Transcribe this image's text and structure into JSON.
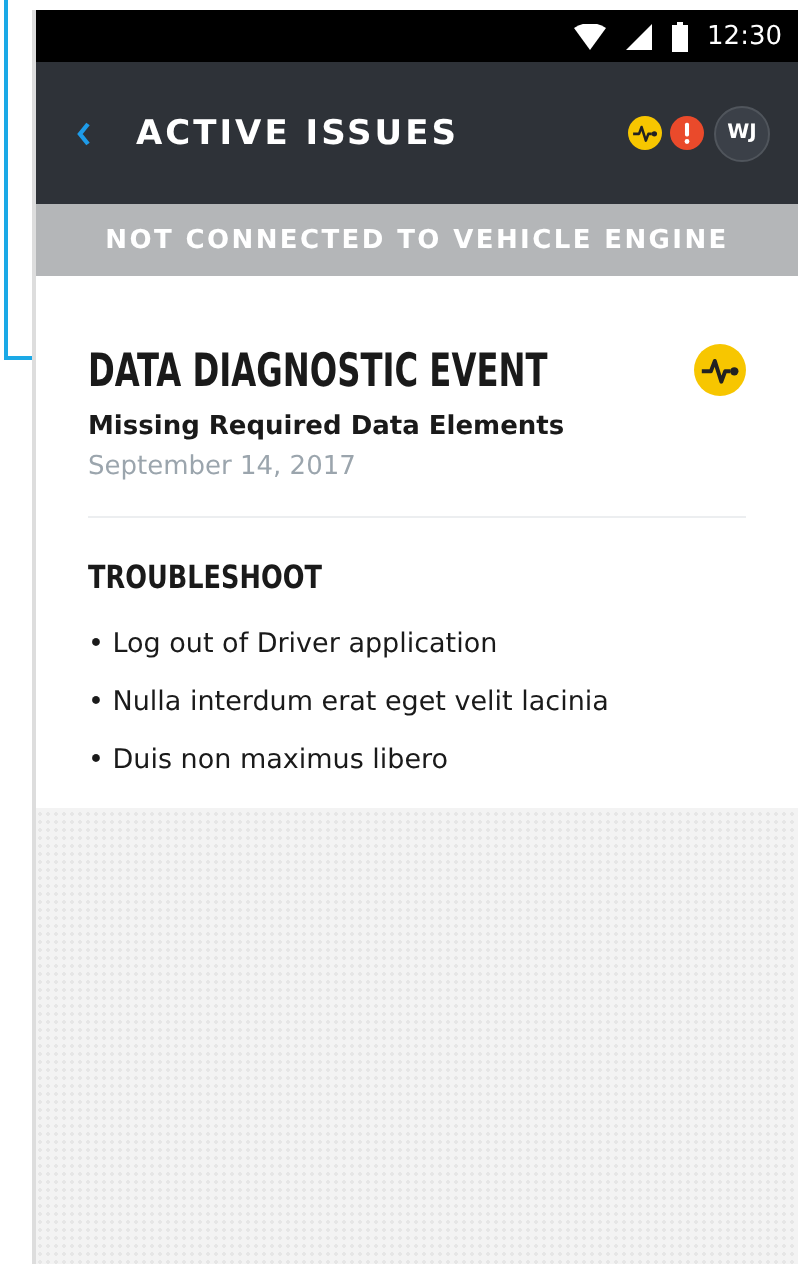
{
  "status_bar": {
    "time": "12:30"
  },
  "header": {
    "title": "ACTIVE ISSUES",
    "indicators": [
      {
        "kind": "diagnostic"
      },
      {
        "kind": "alert"
      }
    ],
    "avatar": "WJ"
  },
  "banner": "NOT CONNECTED TO VEHICLE ENGINE",
  "issue": {
    "kind": "diagnostic",
    "title": "DATA DIAGNOSTIC EVENT",
    "subtitle": "Missing Required Data Elements",
    "date": "September 14, 2017"
  },
  "troubleshoot": {
    "heading": "TROUBLESHOOT",
    "steps": [
      "• Log out of Driver application",
      "• Nulla interdum erat eget velit lacinia",
      "• Duis non maximus libero"
    ]
  }
}
